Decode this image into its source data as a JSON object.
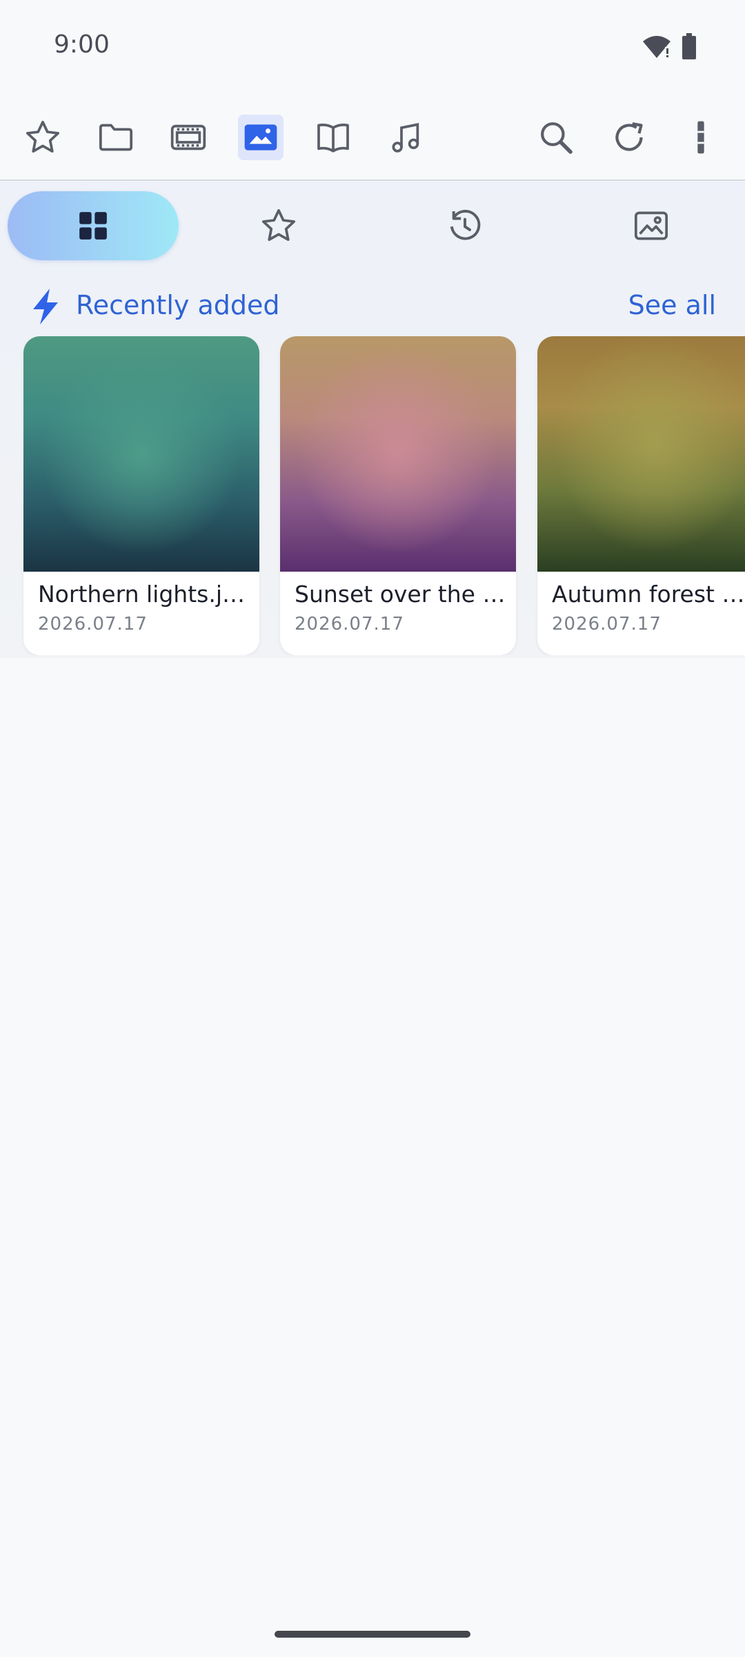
{
  "status_bar": {
    "time": "9:00"
  },
  "toolbar": {
    "items": [
      {
        "icon": "star-icon"
      },
      {
        "icon": "folder-icon"
      },
      {
        "icon": "video-icon"
      },
      {
        "icon": "image-icon",
        "active": true
      },
      {
        "icon": "book-icon"
      },
      {
        "icon": "music-icon"
      },
      {
        "icon": "search-icon"
      },
      {
        "icon": "refresh-icon"
      },
      {
        "icon": "more-vert-icon"
      }
    ],
    "accent_color": "#2f63d4"
  },
  "tabs": [
    {
      "icon": "grid-icon",
      "selected": true
    },
    {
      "icon": "star-icon"
    },
    {
      "icon": "history-icon"
    },
    {
      "icon": "photo-icon"
    }
  ],
  "section": {
    "title": "Recently added",
    "see_all": "See all"
  },
  "cards": [
    {
      "title": "Northern lights.jpg",
      "date": "2026.07.17"
    },
    {
      "title": "Sunset over the b…",
      "date": "2026.07.17"
    },
    {
      "title": "Autumn forest tr…",
      "date": "2026.07.17"
    }
  ]
}
